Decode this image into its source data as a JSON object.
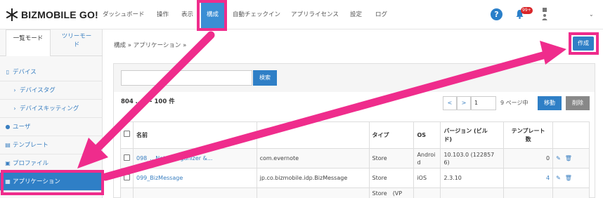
{
  "app": {
    "logo_text": "BIZMOBILE GO!"
  },
  "nav": {
    "items": [
      {
        "label": "ダッシュボード"
      },
      {
        "label": "操作"
      },
      {
        "label": "表示"
      },
      {
        "label": "構成"
      },
      {
        "label": "自動チェックイン"
      },
      {
        "label": "アプリライセンス"
      },
      {
        "label": "設定"
      },
      {
        "label": "ログ"
      }
    ],
    "active_item": "構成",
    "notification_badge": "99+",
    "icons": [
      "help-icon",
      "bell-icon",
      "user-icon",
      "chevron-down-icon"
    ]
  },
  "sidebar": {
    "tabs": [
      {
        "label": "一覧モード"
      },
      {
        "label": "ツリーモード"
      }
    ],
    "tree_tab_line1": "ツリーモー",
    "tree_tab_line2": "ド",
    "items": [
      {
        "label": "デバイス",
        "icon": "device-icon"
      },
      {
        "label": "デバイスタグ",
        "icon": "chevron-right-icon"
      },
      {
        "label": "デバイスキッティング",
        "icon": "chevron-right-icon"
      },
      {
        "label": "ユーザ",
        "icon": "user-icon"
      },
      {
        "label": "テンプレート",
        "icon": "file-icon"
      },
      {
        "label": "プロファイル",
        "icon": "lock-icon"
      },
      {
        "label": "アプリケーション",
        "icon": "grid-icon"
      }
    ],
    "active_item": "アプリケーション"
  },
  "main": {
    "breadcrumb": "構成 » アプリケーション »",
    "create_label": "作成",
    "search": {
      "value": "",
      "button_label": "検索"
    },
    "count_text": "804 … 1 - 100 件",
    "pager": {
      "prev_label": "<",
      "next_label": ">",
      "page_value": "1",
      "page_info": "9 ページ中",
      "move_label": "移動",
      "delete_label": "削除"
    },
    "table": {
      "headers": [
        "",
        "名前",
        "",
        "タイプ",
        "OS",
        "バージョン (ビルド)",
        "テンプレート数",
        ""
      ],
      "header_version_line1": "バージョン (ビル",
      "header_version_line2": "ド)",
      "header_template_line1": "テンプレート",
      "header_template_line2": "数",
      "rows": [
        {
          "name": "098_…Notes Organizer &...",
          "identifier": "com.evernote",
          "type": "Store",
          "os_line1": "Androi",
          "os_line2": "d",
          "version_line1": "10.103.0 (122857",
          "version_line2": "6)",
          "template_count": "0"
        },
        {
          "name": "099_BizMessage",
          "identifier": "jp.co.bizmobile.idp.BizMessage",
          "type": "Store",
          "os_line1": "iOS",
          "os_line2": "",
          "version_line1": "2.3.10",
          "version_line2": "",
          "template_count": "4"
        },
        {
          "name": "",
          "identifier": "",
          "type": "Store　(VP",
          "os_line1": "",
          "os_line2": "",
          "version_line1": "",
          "version_line2": "",
          "template_count": ""
        }
      ]
    }
  },
  "annotation": {
    "highlight_color": "#ef2c8c"
  }
}
